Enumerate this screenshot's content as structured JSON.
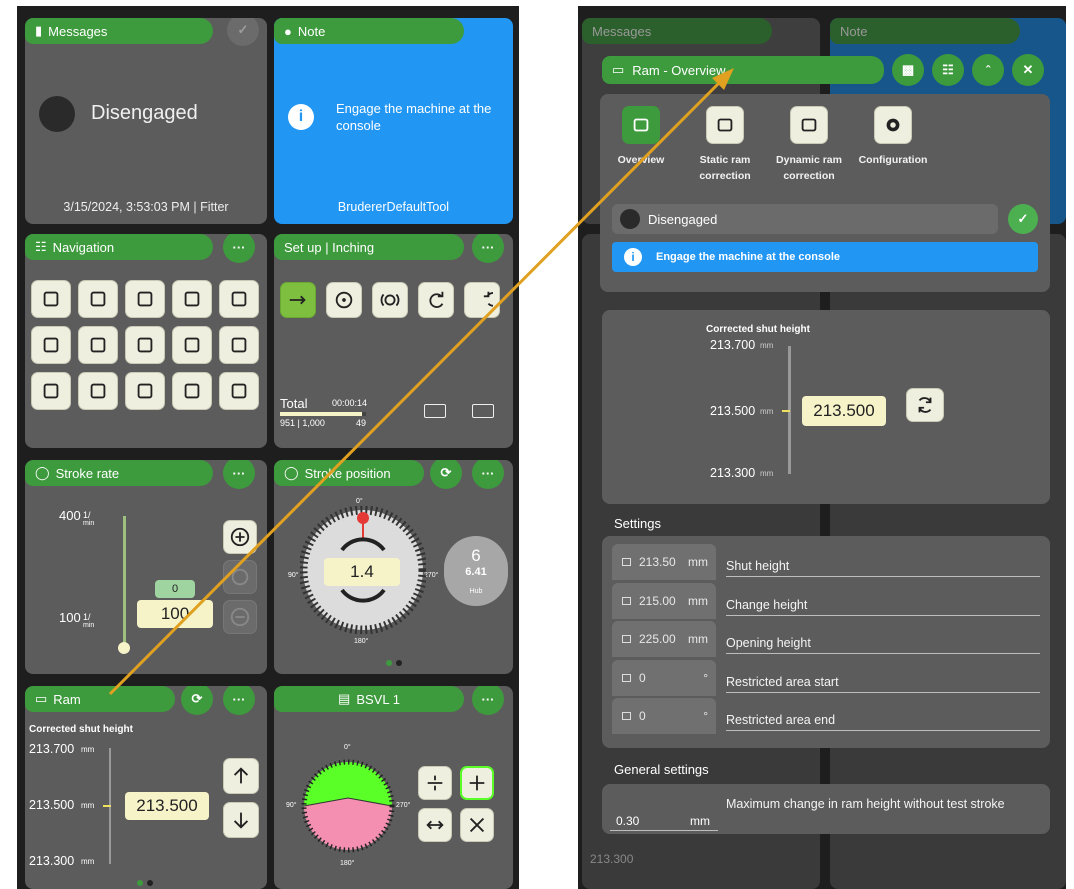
{
  "left": {
    "messages": {
      "title": "Messages",
      "status": "Disengaged",
      "footer": "3/15/2024, 3:53:03 PM | Fitter"
    },
    "note": {
      "title": "Note",
      "text": "Engage the machine at the console",
      "footer": "BrudererDefaultTool"
    },
    "navigation": {
      "title": "Navigation",
      "more": "···"
    },
    "setup": {
      "title": "Set up | Inching",
      "more": "···",
      "total_label": "Total",
      "total_time": "00:00:14",
      "count": "951 | 1,000",
      "remaining": "49"
    },
    "stroke_rate": {
      "title": "Stroke rate",
      "more": "···",
      "max": "400",
      "max_unit": "1/",
      "max_unit2": "min",
      "min": "100",
      "min_unit": "1/",
      "min_unit2": "min",
      "offset": "0",
      "value": "100"
    },
    "stroke_position": {
      "title": "Stroke position",
      "more": "···",
      "deg_top": "0°",
      "deg_left": "90°",
      "deg_right": "270°",
      "deg_bottom": "180°",
      "value": "1.4",
      "hub_count": "6",
      "hub_value": "6.41",
      "hub_label": "Hub"
    },
    "ram": {
      "title": "Ram",
      "more": "···",
      "label": "Corrected shut height",
      "top": "213.700",
      "unit": "mm",
      "mid": "213.500",
      "bottom": "213.300",
      "value": "213.500"
    },
    "bsvl": {
      "title": "BSVL 1",
      "more": "···",
      "deg_top": "0°",
      "deg_left": "90°",
      "deg_right": "270°",
      "deg_bottom": "180°"
    }
  },
  "right": {
    "bg_messages": "Messages",
    "bg_note": "Note",
    "dialog": {
      "title": "Ram - Overview",
      "tabs": [
        {
          "label": "Overview"
        },
        {
          "label": "Static ram correction"
        },
        {
          "label": "Dynamic ram correction"
        },
        {
          "label": "Configuration"
        }
      ],
      "status": "Disengaged",
      "note": "Engage the machine at the console",
      "gauge": {
        "label": "Corrected shut height",
        "top": "213.700",
        "mid": "213.500",
        "bottom": "213.300",
        "unit": "mm",
        "value": "213.500"
      },
      "settings_title": "Settings",
      "settings": [
        {
          "value": "213.50",
          "unit": "mm",
          "label": "Shut height"
        },
        {
          "value": "215.00",
          "unit": "mm",
          "label": "Change height"
        },
        {
          "value": "225.00",
          "unit": "mm",
          "label": "Opening height"
        },
        {
          "value": "0",
          "unit": "°",
          "label": "Restricted area start"
        },
        {
          "value": "0",
          "unit": "°",
          "label": "Restricted area end"
        }
      ],
      "general_title": "General settings",
      "general": {
        "value": "0.30",
        "unit": "mm",
        "label": "Maximum change in ram height without test stroke"
      },
      "bg_bottom": "213.300"
    }
  },
  "colors": {
    "green": "#3d9a3d",
    "blue": "#2196f3",
    "card": "#5c5c5c",
    "accent": "#f6f3c9",
    "arrow": "#e0a020"
  }
}
